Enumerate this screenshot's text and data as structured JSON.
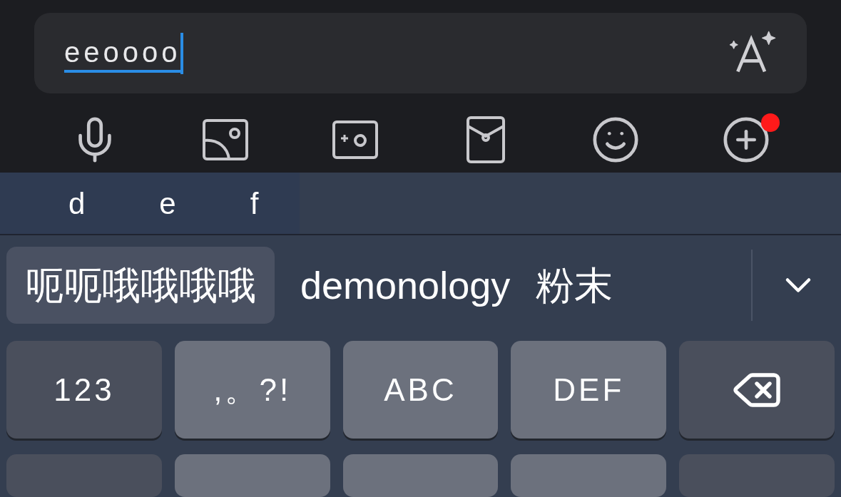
{
  "input": {
    "value": "eeoooo",
    "composing": true
  },
  "toolbar": [
    {
      "kind": "mic",
      "badge": false
    },
    {
      "kind": "image",
      "badge": false
    },
    {
      "kind": "camera",
      "badge": false
    },
    {
      "kind": "envelope",
      "badge": false
    },
    {
      "kind": "emoji",
      "badge": false
    },
    {
      "kind": "plus",
      "badge": true
    }
  ],
  "pinyin": [
    "d",
    "e",
    "f"
  ],
  "candidates": [
    {
      "text": "呃呃哦哦哦哦",
      "selected": true
    },
    {
      "text": "demonology",
      "selected": false
    },
    {
      "text": "粉末",
      "selected": false
    }
  ],
  "keys": [
    {
      "label": "123",
      "kind": "function"
    },
    {
      "label": ",。?!",
      "kind": "letter"
    },
    {
      "label": "ABC",
      "kind": "letter"
    },
    {
      "label": "DEF",
      "kind": "letter"
    },
    {
      "kind": "delete"
    }
  ],
  "next_row_keys": [
    {
      "kind": "function"
    },
    {
      "kind": "letter"
    },
    {
      "kind": "letter"
    },
    {
      "kind": "letter"
    },
    {
      "kind": "function"
    }
  ]
}
